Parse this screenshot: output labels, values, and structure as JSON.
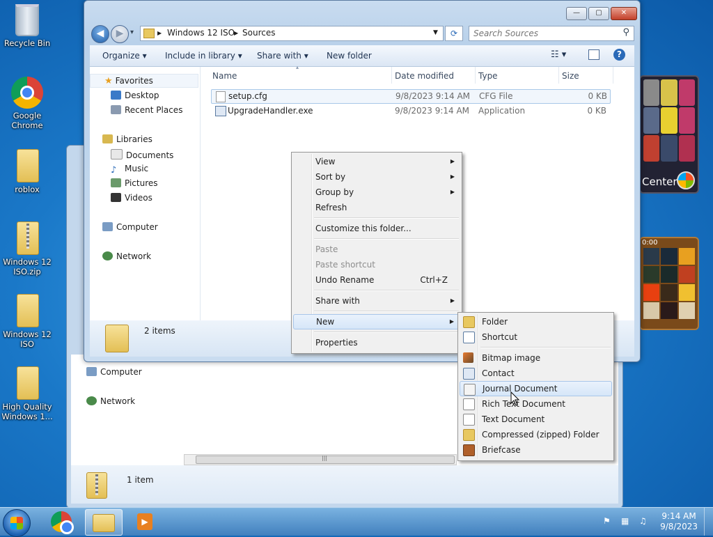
{
  "desktop": {
    "icons": [
      {
        "label": "Recycle Bin"
      },
      {
        "label": "Google Chrome"
      },
      {
        "label": "roblox"
      },
      {
        "label": "Windows 12 ISO.zip"
      },
      {
        "label": "Windows 12 ISO"
      },
      {
        "label": "High Quality Windows 1..."
      }
    ]
  },
  "gadgets": {
    "media_center_label": "Center",
    "puzzle_timer": "0:00"
  },
  "back_window": {
    "nav": {
      "computer": "Computer",
      "network": "Network"
    },
    "status": "1 item",
    "scroll_glyph": "|||"
  },
  "window": {
    "title_buttons": {
      "minimize": "—",
      "maximize": "▢",
      "close": "✕"
    },
    "nav": {
      "back": "◀",
      "forward": "▶",
      "dropdown": "▾"
    },
    "breadcrumb": [
      "Windows 12 ISO",
      "Sources"
    ],
    "search": {
      "placeholder": "Search Sources"
    },
    "toolbar": {
      "organize": "Organize",
      "include": "Include in library",
      "share": "Share with",
      "new_folder": "New folder"
    },
    "nav_pane": {
      "favorites": "Favorites",
      "desktop": "Desktop",
      "recent": "Recent Places",
      "libraries": "Libraries",
      "documents": "Documents",
      "music": "Music",
      "pictures": "Pictures",
      "videos": "Videos",
      "computer": "Computer",
      "network": "Network"
    },
    "columns": {
      "name": "Name",
      "date": "Date modified",
      "type": "Type",
      "size": "Size"
    },
    "files": [
      {
        "name": "setup.cfg",
        "date": "9/8/2023 9:14 AM",
        "type": "CFG File",
        "size": "0 KB"
      },
      {
        "name": "UpgradeHandler.exe",
        "date": "9/8/2023 9:14 AM",
        "type": "Application",
        "size": "0 KB"
      }
    ],
    "status": "2 items"
  },
  "context_menu": {
    "view": "View",
    "sort_by": "Sort by",
    "group_by": "Group by",
    "refresh": "Refresh",
    "customize": "Customize this folder...",
    "paste": "Paste",
    "paste_shortcut": "Paste shortcut",
    "undo_rename": "Undo Rename",
    "undo_shortcut": "Ctrl+Z",
    "share_with": "Share with",
    "new": "New",
    "properties": "Properties",
    "arrow": "▶"
  },
  "new_submenu": {
    "folder": "Folder",
    "shortcut": "Shortcut",
    "bitmap": "Bitmap image",
    "contact": "Contact",
    "journal": "Journal Document",
    "rtf": "Rich Text Document",
    "text": "Text Document",
    "zip": "Compressed (zipped) Folder",
    "briefcase": "Briefcase"
  },
  "taskbar": {
    "time": "9:14 AM",
    "date": "9/8/2023"
  }
}
